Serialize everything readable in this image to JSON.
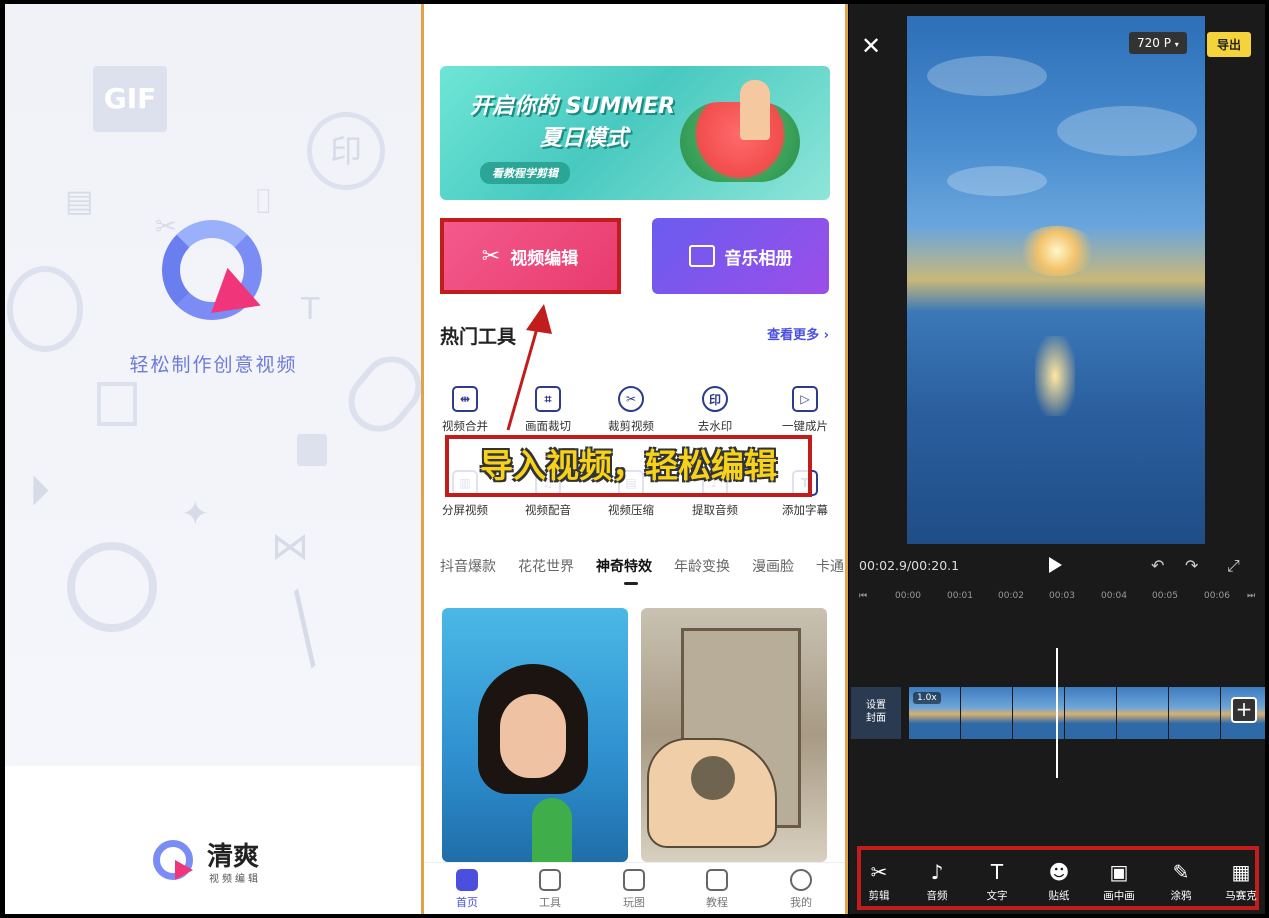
{
  "splash": {
    "slogan": "轻松制作创意视频",
    "gif_label": "GIF",
    "stamp_label": "印",
    "brand_name": "清爽",
    "brand_sub": "视频编辑"
  },
  "home": {
    "banner": {
      "title_line1": "开启你的 SUMMER",
      "title_line2": "夏日模式",
      "pill": "看教程学剪辑"
    },
    "video_edit_label": "视频编辑",
    "music_album_label": "音乐相册",
    "hot_tools_title": "热门工具",
    "see_more": "查看更多 ›",
    "tools_row1": [
      "视频合并",
      "画面裁切",
      "裁剪视频",
      "去水印",
      "一键成片"
    ],
    "tools_row2": [
      "分屏视频",
      "视频配音",
      "视频压缩",
      "提取音频",
      "添加字幕"
    ],
    "caption": "导入视频，轻松编辑",
    "tabs": [
      "抖音爆款",
      "花花世界",
      "神奇特效",
      "年龄变换",
      "漫画脸",
      "卡通"
    ],
    "active_tab": "神奇特效",
    "nav": [
      "首页",
      "工具",
      "玩图",
      "教程",
      "我的"
    ]
  },
  "editor": {
    "resolution": "720 P",
    "export_label": "导出",
    "close": "✕",
    "time": "00:02.9/00:20.1",
    "ruler": [
      "00:00",
      "00:01",
      "00:02",
      "00:03",
      "00:04",
      "00:05",
      "00:06"
    ],
    "cover_label_1": "设置",
    "cover_label_2": "封面",
    "speed": "1.0x",
    "tools": [
      {
        "label": "剪辑",
        "icon": "✂"
      },
      {
        "label": "音频",
        "icon": "♪"
      },
      {
        "label": "文字",
        "icon": "T"
      },
      {
        "label": "贴纸",
        "icon": "☻"
      },
      {
        "label": "画中画",
        "icon": "▣"
      },
      {
        "label": "涂鸦",
        "icon": "✎"
      },
      {
        "label": "马赛克",
        "icon": "▦"
      }
    ]
  },
  "colors": {
    "highlight_red": "#c21d1d",
    "caption_yellow": "#f6d21a",
    "accent_blue": "#4a4fe0",
    "export_yellow": "#f5d33a"
  }
}
